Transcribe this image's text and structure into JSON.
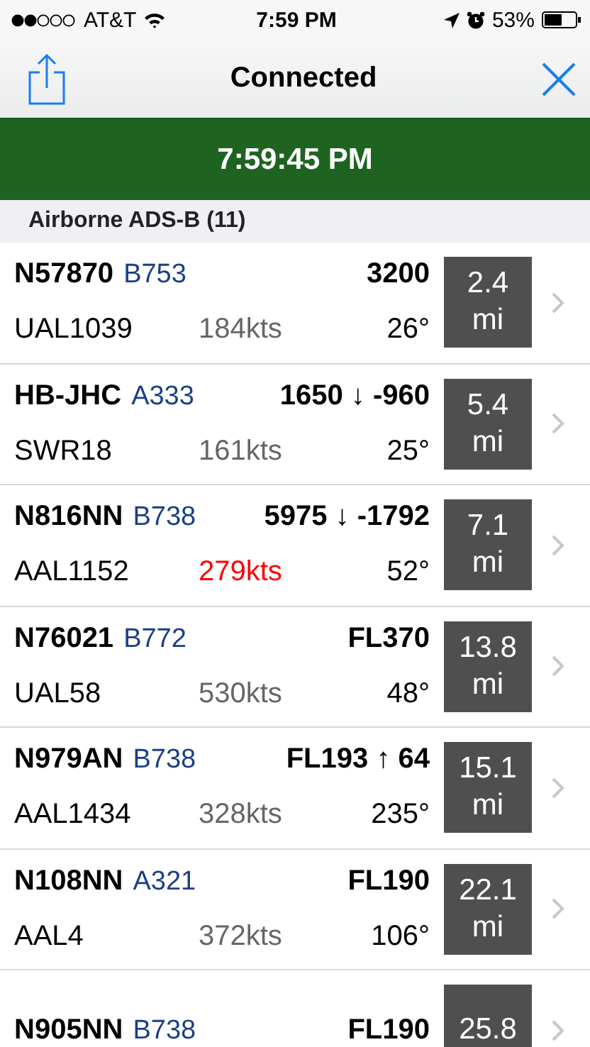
{
  "status_bar": {
    "carrier": "AT&T",
    "time": "7:59 PM",
    "battery": "53%"
  },
  "nav": {
    "title": "Connected"
  },
  "banner": {
    "time": "7:59:45 PM"
  },
  "section": {
    "title": "Airborne ADS-B (11)"
  },
  "rows": [
    {
      "tail": "N57870",
      "type": "B753",
      "altitude": "3200",
      "callsign": "UAL1039",
      "speed": "184kts",
      "speed_alert": false,
      "heading": "26°",
      "distance": "2.4",
      "unit": "mi"
    },
    {
      "tail": "HB-JHC",
      "type": "A333",
      "altitude": "1650 ↓ -960",
      "callsign": "SWR18",
      "speed": "161kts",
      "speed_alert": false,
      "heading": "25°",
      "distance": "5.4",
      "unit": "mi"
    },
    {
      "tail": "N816NN",
      "type": "B738",
      "altitude": "5975 ↓ -1792",
      "callsign": "AAL1152",
      "speed": "279kts",
      "speed_alert": true,
      "heading": "52°",
      "distance": "7.1",
      "unit": "mi"
    },
    {
      "tail": "N76021",
      "type": "B772",
      "altitude": "FL370",
      "callsign": "UAL58",
      "speed": "530kts",
      "speed_alert": false,
      "heading": "48°",
      "distance": "13.8",
      "unit": "mi"
    },
    {
      "tail": "N979AN",
      "type": "B738",
      "altitude": "FL193 ↑ 64",
      "callsign": "AAL1434",
      "speed": "328kts",
      "speed_alert": false,
      "heading": "235°",
      "distance": "15.1",
      "unit": "mi"
    },
    {
      "tail": "N108NN",
      "type": "A321",
      "altitude": "FL190",
      "callsign": "AAL4",
      "speed": "372kts",
      "speed_alert": false,
      "heading": "106°",
      "distance": "22.1",
      "unit": "mi"
    },
    {
      "tail": "N905NN",
      "type": "B738",
      "altitude": "FL190",
      "distance": "25.8"
    }
  ]
}
